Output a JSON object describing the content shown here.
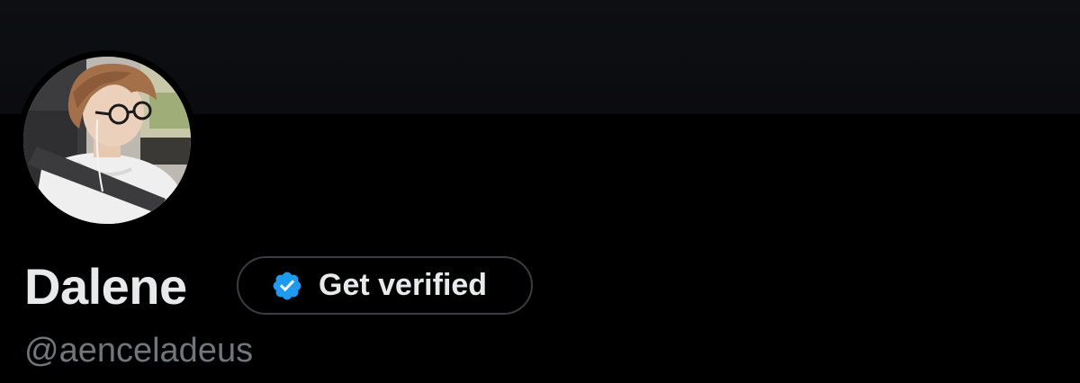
{
  "profile": {
    "display_name": "Dalene",
    "handle": "@aenceladeus",
    "verify_button_label": "Get verified"
  },
  "icons": {
    "verified_badge": "verified-badge-icon"
  },
  "colors": {
    "background": "#000000",
    "banner": "#0e0f13",
    "primary_text": "#e7e9ea",
    "secondary_text": "#71767b",
    "button_border": "#3a3d42",
    "verified_blue": "#1d9bf0"
  }
}
